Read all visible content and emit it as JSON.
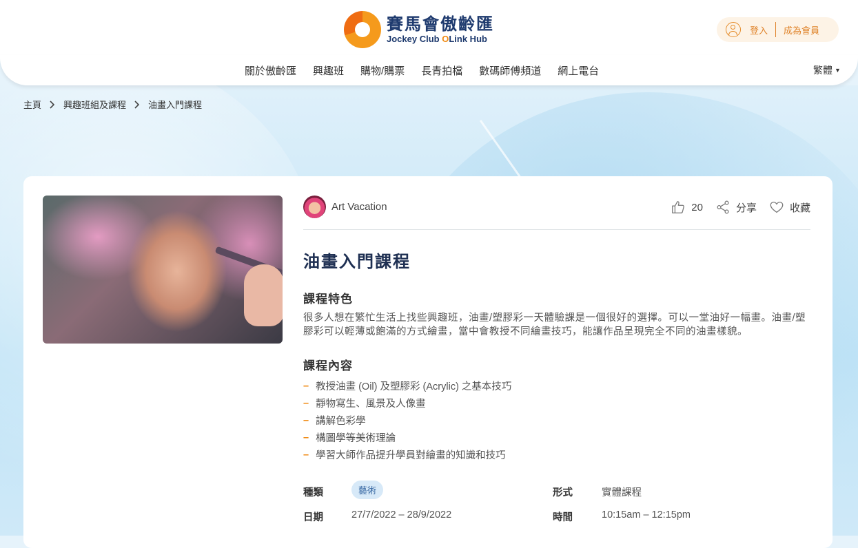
{
  "header": {
    "logo_zh": "賽馬會傲齡匯",
    "logo_en_a": "Jockey Club",
    "logo_en_o": "O",
    "logo_en_b": "Link Hub",
    "login_label": "登入",
    "join_label": "成為會員"
  },
  "nav": {
    "items": [
      "關於傲齡匯",
      "興趣班",
      "購物/購票",
      "長青拍檔",
      "數碼師傅頻道",
      "網上電台"
    ],
    "language": "繁體"
  },
  "breadcrumb": [
    "主頁",
    "興趣班組及課程",
    "油畫入門課程"
  ],
  "course": {
    "author": "Art Vacation",
    "likes": "20",
    "share_label": "分享",
    "favorite_label": "收藏",
    "title": "油畫入門課程",
    "features_heading": "課程特色",
    "features_text": "很多人想在繁忙生活上找些興趣班，油畫/塑膠彩一天體驗課是一個很好的選擇。可以一堂油好一幅畫。油畫/塑膠彩可以輕薄或飽滿的方式繪畫，當中會教授不同繪畫技巧，能讓作品呈現完全不同的油畫樣貌。",
    "content_heading": "課程內容",
    "content_items": [
      "教授油畫 (Oil) 及塑膠彩 (Acrylic) 之基本技巧",
      "靜物寫生、風景及人像畫",
      "講解色彩學",
      "構圖學等美術理論",
      "學習大師作品提升學員對繪畫的知識和技巧"
    ],
    "meta": {
      "category_label": "種類",
      "category_value": "藝術",
      "format_label": "形式",
      "format_value": "實體課程",
      "date_label": "日期",
      "date_value": "27/7/2022 – 28/9/2022",
      "time_label": "時間",
      "time_value": "10:15am – 12:15pm"
    }
  },
  "colors": {
    "brand_orange": "#f08a12",
    "brand_navy": "#1e3a6e",
    "tag_bg": "#d7e9f8"
  }
}
